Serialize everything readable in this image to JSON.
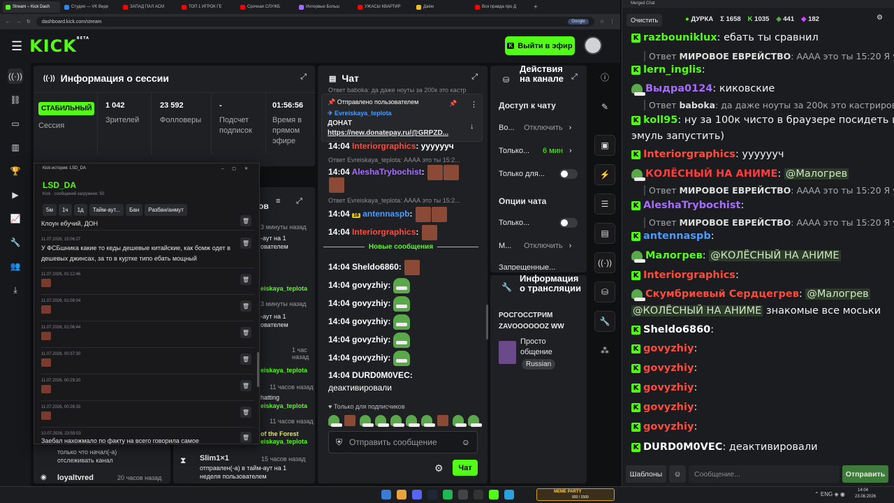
{
  "browser": {
    "tabs": [
      "Stream – Kick Dash",
      "Студия — VK Виде",
      "ЗАПАД ПАЛ АСМ",
      "ТОП 1 ИГРОК ГЕ",
      "Срочная СЛУЖБ",
      "Интервью Больш",
      "УЖАСЫ КВАРТИР",
      "Даём",
      "Вся правда про Д"
    ],
    "url": "dashboard.kick.com/stream",
    "search_pill": "Google"
  },
  "header": {
    "logo": "KICK",
    "logo_sup": "BETA",
    "go_live": "Выйти в эфир"
  },
  "session": {
    "title": "Информация о сессии",
    "badge": "СТАБИЛЬНЫЙ",
    "badge_label": "Сессия",
    "stats": [
      {
        "value": "1 042",
        "label": "Зрителей"
      },
      {
        "value": "23 592",
        "label": "Фолловеры"
      },
      {
        "value": "-",
        "label": "Подсчет подписок"
      },
      {
        "value": "01:56:56",
        "label": "Время в прямом эфире"
      }
    ]
  },
  "history": {
    "window_title": "Kick история: LSD_DA",
    "user": "LSD_DA",
    "subtitle": "Kick · сообщений загружено: 50",
    "buttons": [
      "5м",
      "1ч",
      "1д",
      "Тайм-аут...",
      "Бан",
      "Разбан/анмут"
    ],
    "top_text": "Клоун ебучий, ДОН",
    "entries": [
      {
        "date": "11.07.2026, 15:06:27",
        "text": "У ФСБшника какие то кеды дешевые китайские, как бомж одет в дешевых джинсах, за то в куртке типо ебать мощный"
      },
      {
        "date": "11.07.2026, 01:12:46",
        "text": ""
      },
      {
        "date": "11.07.2026, 01:08:04",
        "text": ""
      },
      {
        "date": "11.07.2026, 01:06:44",
        "text": ""
      },
      {
        "date": "11.07.2026, 00:37:30",
        "text": ""
      },
      {
        "date": "11.07.2026, 00:29:20",
        "text": ""
      },
      {
        "date": "11.07.2026, 00:26:33",
        "text": ""
      },
      {
        "date": "10.07.2026, 23:59:03",
        "text": "Заебал нахожмало по факту на всего говорила самое"
      }
    ]
  },
  "moderation": {
    "header_suffix": "ов",
    "times": [
      "3 минуты назад",
      "3 минуты назад",
      "1 час назад",
      "11 часов назад",
      "11 часов назад"
    ],
    "snippets": [
      "-аут на 1 ователем",
      "eiskaya_teplota",
      "-аут на 1 ователем",
      "eiskaya_teplota",
      "hatting",
      "eiskaya_teplota",
      "of the Forest",
      "eiskaya_teplota"
    ],
    "bottom_left": {
      "text1": "только что начал(-а)",
      "text2": "отслеживать канал",
      "user": "loyaltvred",
      "time": "20 часов назад"
    },
    "bottom_right": {
      "user": "Slim1×1",
      "time": "15 часов назад",
      "text1": "отправлен(-а) в тайм-аут на 1",
      "text2": "неделя пользователем"
    }
  },
  "chat": {
    "title": "Чат",
    "pinned_label": "Отправлено пользователем",
    "pinned_user": "Evreiskaya_teplota",
    "pinned_text": "ДОНАТ",
    "pinned_link": "https://new.donatepay.ru/@GRPZD...",
    "top_reply": "Ответ baboka: да даже ноуты за 200к это кастр",
    "messages": [
      {
        "time": "14:04",
        "user": "Interiorgraphics",
        "color": "#ff4a3a",
        "text": "ууууууч"
      },
      {
        "time": "14:04",
        "user": "AleshaTrybochist",
        "color": "#a76bff",
        "text": ""
      },
      {
        "time": "14:04",
        "user": "antennaspb",
        "color": "#4a9bff",
        "badge": "16",
        "text": ""
      },
      {
        "time": "14:04",
        "user": "Interiorgraphics",
        "color": "#ff4a3a",
        "text": ""
      }
    ],
    "reply_1": "Ответ Evreiskaya_teplota: АААА это ты 15:2...",
    "new_messages": "Новые сообщения",
    "after": [
      {
        "time": "14:04",
        "user": "Sheldo6860",
        "color": "#ffffff"
      },
      {
        "time": "14:04",
        "user": "govyzhiy",
        "color": "#ffffff"
      },
      {
        "time": "14:04",
        "user": "govyzhiy",
        "color": "#ffffff"
      },
      {
        "time": "14:04",
        "user": "govyzhiy",
        "color": "#ffffff"
      },
      {
        "time": "14:04",
        "user": "govyzhiy",
        "color": "#ffffff"
      },
      {
        "time": "14:04",
        "user": "govyzhiy",
        "color": "#ffffff"
      }
    ],
    "last": {
      "time": "14:04",
      "user": "DURD0M0VEC",
      "text": "деактивировали"
    },
    "subs_only": "Только для подписчиков",
    "input_placeholder": "Отправить сообщение",
    "send": "Чат"
  },
  "actions": {
    "title": "Действия на канале",
    "chat_access": "Доступ к чату",
    "rows": [
      {
        "label": "Во...",
        "value": "Отключить"
      },
      {
        "label": "Только...",
        "value": "6 мин"
      },
      {
        "label": "Только для...",
        "value": ""
      }
    ],
    "chat_options": "Опции чата",
    "opt_rows": [
      {
        "label": "Только...",
        "value": ""
      },
      {
        "label": "М...",
        "value": "Отключить"
      },
      {
        "label": "Запрещенные...",
        "value": ""
      }
    ],
    "stream_info_title": "Информация о трансляции",
    "stream_title": "РОСГОССТРИМ ZAVOOOOOOZ WW",
    "category": "Просто общение",
    "language": "Russian"
  },
  "merged": {
    "window_title": "Merged Chat",
    "clear": "Очистить",
    "channel": "ДУРКА",
    "total": "Σ 1658",
    "kick_count": "1035",
    "other_count": "441",
    "third_count": "182",
    "templates": "Шаблоны",
    "input_placeholder": "Сообщение...",
    "send": "Отправить",
    "lines": [
      {
        "type": "msg",
        "src": "k",
        "user": "razbouniklux",
        "color": "#53fc18",
        "text": ": ебать ты сравнил"
      },
      {
        "type": "reply",
        "who": "МИРОВОЕ ЕВРЕЙСТВО",
        "text": ": АААА это ты 15:20 Я уже ..."
      },
      {
        "type": "msg",
        "src": "k",
        "user": "lern_inglis",
        "color": "#53fc18",
        "text": ": ",
        "face": true
      },
      {
        "type": "msg",
        "src": "t",
        "user": "Выдра0124",
        "color": "#a76bff",
        "text": ": киковские"
      },
      {
        "type": "reply",
        "who": "baboka",
        "text": ": да даже ноуты за 200к это кастрированн..."
      },
      {
        "type": "msg",
        "src": "k",
        "user": "koll95",
        "color": "#53fc18",
        "text": ": ну за 100к чисто в браузере посидеть и"
      },
      {
        "type": "cont",
        "text": "эмуль запустить)"
      },
      {
        "type": "msg",
        "src": "k",
        "user": "Interiorgraphics",
        "color": "#ff4a3a",
        "text": ": ууууууч"
      },
      {
        "type": "msg",
        "src": "t",
        "user": "КОЛЁСНЫЙ НА АНИМЕ",
        "color": "#ff3b3b",
        "text": ": ",
        "mention": "@Малогрев"
      },
      {
        "type": "reply",
        "who": "МИРОВОЕ ЕВРЕЙСТВО",
        "text": ": АААА это ты 15:20 Я уже ..."
      },
      {
        "type": "msg",
        "src": "k",
        "user": "AleshaTrybochist",
        "color": "#a76bff",
        "text": ": "
      },
      {
        "type": "reply",
        "who": "МИРОВОЕ ЕВРЕЙСТВО",
        "text": ": АААА это ты 15:20 Я уже ..."
      },
      {
        "type": "msg",
        "src": "k",
        "user": "antennaspb",
        "color": "#4a9bff",
        "text": ": "
      },
      {
        "type": "msg",
        "src": "t",
        "user": "Малогрев",
        "color": "#53fc18",
        "text": ": ",
        "mention": "@КОЛЁСНЫЙ НА АНИМЕ"
      },
      {
        "type": "msg",
        "src": "k",
        "user": "Interiorgraphics",
        "color": "#ff4a3a",
        "text": ": "
      },
      {
        "type": "msg",
        "src": "t",
        "user": "Скумбриевый Сердцегрев",
        "color": "#ff4a3a",
        "text": ": ",
        "mention": "@Малогрев"
      },
      {
        "type": "cont",
        "mention": "@КОЛЁСНЫЙ НА АНИМЕ",
        "text": " знакомые все моськи"
      },
      {
        "type": "msg",
        "src": "k",
        "user": "Sheldo6860",
        "color": "#ffffff",
        "text": ": "
      },
      {
        "type": "msg",
        "src": "k",
        "user": "govyzhiy",
        "color": "#ff4a3a",
        "text": ": "
      },
      {
        "type": "msg",
        "src": "k",
        "user": "govyzhiy",
        "color": "#ff4a3a",
        "text": ": "
      },
      {
        "type": "msg",
        "src": "k",
        "user": "govyzhiy",
        "color": "#ff4a3a",
        "text": ": "
      },
      {
        "type": "msg",
        "src": "k",
        "user": "govyzhiy",
        "color": "#ff4a3a",
        "text": ": "
      },
      {
        "type": "msg",
        "src": "k",
        "user": "govyzhiy",
        "color": "#ff4a3a",
        "text": ": "
      },
      {
        "type": "msg",
        "src": "k",
        "user": "DURD0M0VEC",
        "color": "#ffffff",
        "text": ": деактивировали"
      }
    ]
  },
  "taskbar": {
    "meme_party": "MEME PARTY",
    "meme_count": "920 / 1500",
    "time": "14:04",
    "date": "23.08.2026"
  },
  "icons": [
    "broadcast-icon",
    "link-icon",
    "window-icon",
    "chart-icon",
    "trophy-icon",
    "video-icon",
    "growth-icon",
    "wrench-icon",
    "users-icon",
    "download-icon"
  ]
}
